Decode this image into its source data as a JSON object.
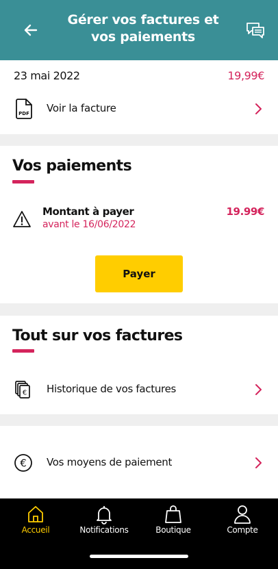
{
  "header": {
    "title": "Gérer vos factures et vos paiements",
    "back_icon": "arrow-left-icon",
    "chat_icon": "chat-bubbles-icon",
    "background": "#3a8f96"
  },
  "invoice": {
    "date": "23 mai 2022",
    "amount": "19,99€",
    "view_label": "Voir la facture",
    "pdf_icon_text": "PDF"
  },
  "payments": {
    "title": "Vos paiements",
    "amount_title": "Montant à payer",
    "amount_due_date": "avant le 16/06/2022",
    "amount_value": "19.99€",
    "pay_button": "Payer"
  },
  "invoices_info": {
    "title": "Tout sur vos factures",
    "history_label": "Historique de vos factures",
    "payment_methods_label": "Vos moyens de paiement"
  },
  "tabbar": {
    "tabs": [
      {
        "label": "Accueil",
        "icon": "home-icon",
        "active": true
      },
      {
        "label": "Notifications",
        "icon": "bell-icon",
        "active": false
      },
      {
        "label": "Boutique",
        "icon": "shopping-bag-icon",
        "active": false
      },
      {
        "label": "Compte",
        "icon": "user-icon",
        "active": false
      }
    ]
  },
  "colors": {
    "accent": "#d4245c",
    "button": "#ffcd00",
    "tab_active": "#ffcd00"
  }
}
